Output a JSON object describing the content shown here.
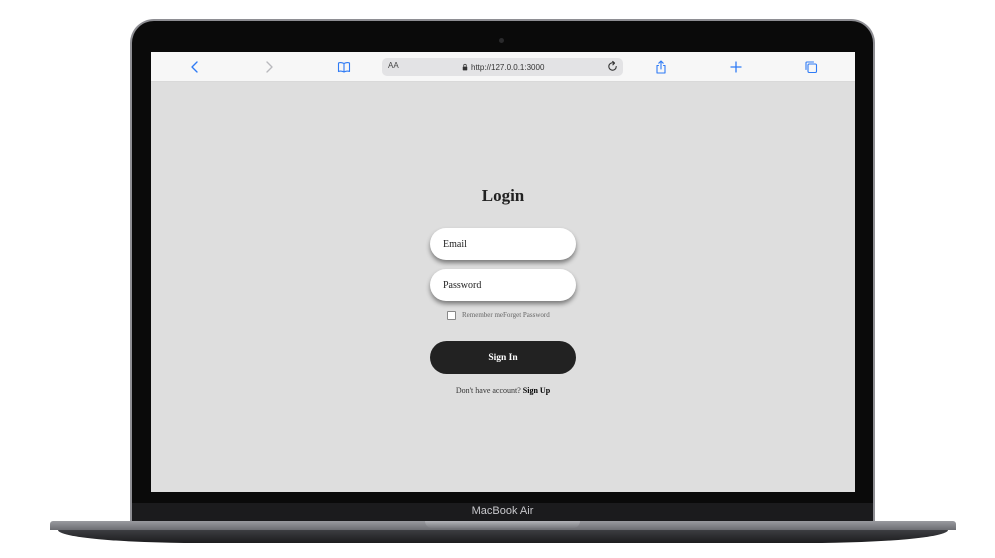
{
  "device": {
    "label": "MacBook Air"
  },
  "browser": {
    "text_size_label": "AA",
    "url": "http://127.0.0.1:3000",
    "icons": [
      "back-icon",
      "forward-icon",
      "bookmarks-icon",
      "lock-icon",
      "reload-icon",
      "share-icon",
      "new-tab-icon",
      "tabs-icon"
    ],
    "accent_color": "#2f7bf5"
  },
  "login": {
    "title": "Login",
    "email_placeholder": "Email",
    "password_placeholder": "Password",
    "remember_label": "Remember me",
    "forgot_label": "Forget Password",
    "signin_label": "Sign In",
    "no_account_text": "Don't have account?",
    "signup_label": "Sign Up"
  },
  "colors": {
    "page_background": "#dedede",
    "button_background": "#222222"
  }
}
